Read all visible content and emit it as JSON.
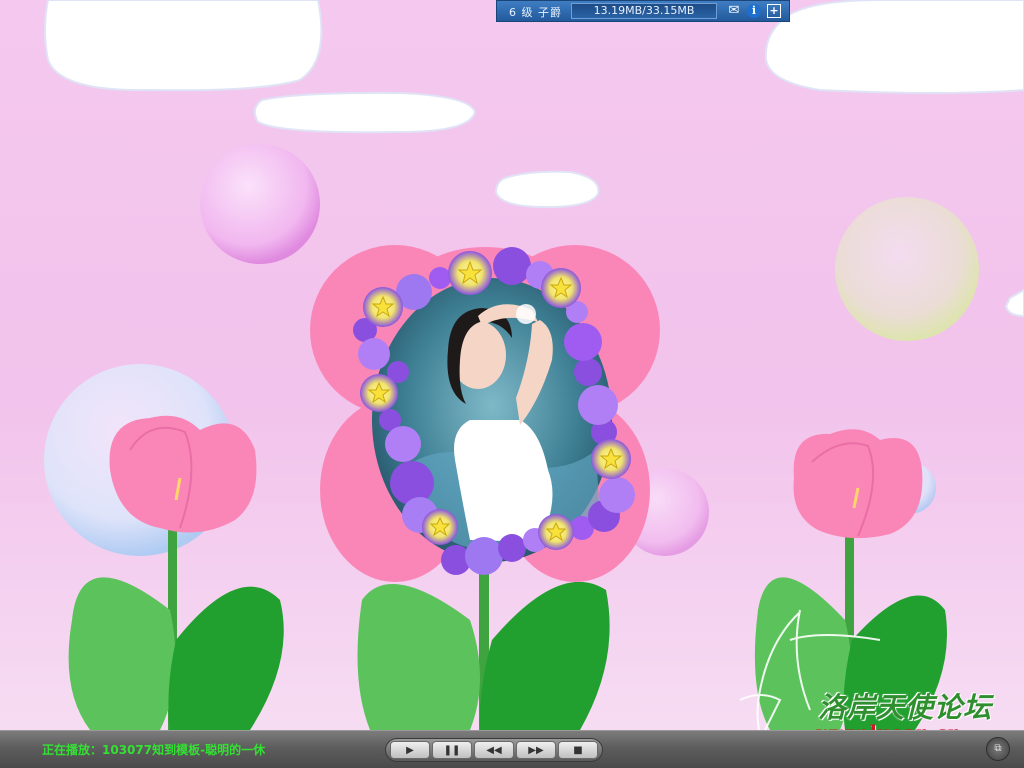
{
  "status_panel": {
    "level_text": "6 级 子爵",
    "download_size": "13.19MB/33.15MB",
    "mail_icon": "envelope",
    "info_icon": "i",
    "expand_icon": "plus-box"
  },
  "watermark": {
    "title": "洛岸天使论坛",
    "url": "www.luoan.cn"
  },
  "player": {
    "now_playing": "正在播放：103077知到模板-聪明的一休",
    "controls": [
      "play",
      "pause",
      "rewind",
      "fast-forward",
      "stop"
    ],
    "accent_color": "#33e133"
  },
  "colors": {
    "background": "#f3c6ec",
    "tulip_pink": "#fa86b8",
    "leaf_green": "#3aa83a",
    "bead_purple": "#9a5ce6"
  }
}
